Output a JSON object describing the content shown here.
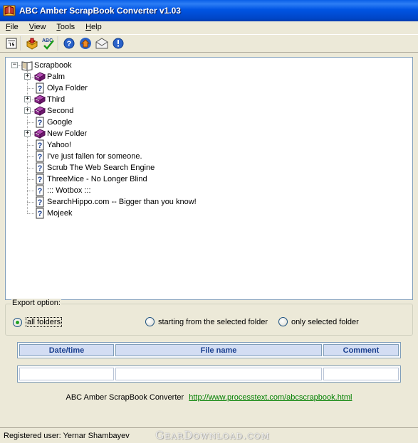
{
  "window": {
    "title": "ABC Amber ScrapBook Converter v1.03",
    "icon": "scrapbook-app-icon"
  },
  "menu": [
    "File",
    "View",
    "Tools",
    "Help"
  ],
  "toolbar": {
    "buttons": [
      "export-icon",
      "open-icon",
      "spellcheck-icon",
      "help-icon",
      "home-icon",
      "mail-icon",
      "info-icon"
    ],
    "spellcheck_text": "ABC"
  },
  "tree": {
    "root": {
      "label": "Scrapbook",
      "expanded": true
    },
    "items": [
      {
        "label": "Palm",
        "type": "folder",
        "expandable": true
      },
      {
        "label": "Olya Folder",
        "type": "page",
        "expandable": false
      },
      {
        "label": "Third",
        "type": "folder",
        "expandable": true
      },
      {
        "label": "Second",
        "type": "folder",
        "expandable": true
      },
      {
        "label": "Google",
        "type": "page",
        "expandable": false
      },
      {
        "label": "New Folder",
        "type": "folder",
        "expandable": true
      },
      {
        "label": "Yahoo!",
        "type": "page",
        "expandable": false
      },
      {
        "label": "I've just fallen for someone.",
        "type": "page",
        "expandable": false
      },
      {
        "label": "Scrub The Web Search Engine",
        "type": "page",
        "expandable": false
      },
      {
        "label": "ThreeMice - No Longer Blind",
        "type": "page",
        "expandable": false
      },
      {
        "label": "::: Wotbox :::",
        "type": "page",
        "expandable": false
      },
      {
        "label": "SearchHippo.com -- Bigger than you know!",
        "type": "page",
        "expandable": false
      },
      {
        "label": "Mojeek",
        "type": "page",
        "expandable": false
      }
    ]
  },
  "export": {
    "legend": "Export option:",
    "options": [
      {
        "label": "all folders",
        "checked": true
      },
      {
        "label": "starting from the selected folder",
        "checked": false
      },
      {
        "label": "only selected folder",
        "checked": false
      }
    ]
  },
  "table": {
    "headers": [
      "Date/time",
      "File name",
      "Comment"
    ]
  },
  "footer": {
    "product": "ABC Amber ScrapBook Converter",
    "url": "http://www.processtext.com/abcscrapbook.html"
  },
  "status": {
    "text": "Registered user: Yernar Shambayev"
  },
  "watermark": "GearDownload.com",
  "colors": {
    "titlebar": "#0054e3",
    "link": "#008000",
    "header_text": "#1a3f8f",
    "folder": "#8b2a8b"
  }
}
